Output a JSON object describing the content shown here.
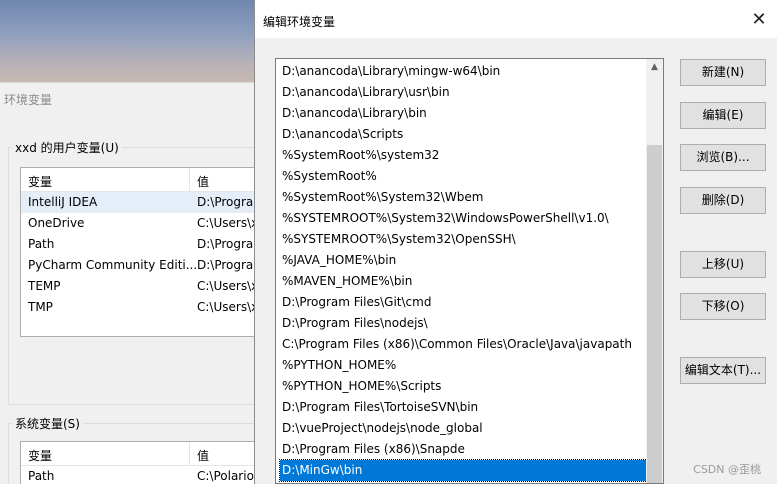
{
  "background_window": {
    "title": "环境变量",
    "user_vars": {
      "group_label": "xxd 的用户变量(U)",
      "columns": [
        "变量",
        "值"
      ],
      "rows": [
        {
          "name": "IntelliJ IDEA",
          "value": "D:\\Progra"
        },
        {
          "name": "OneDrive",
          "value": "C:\\Users\\x"
        },
        {
          "name": "Path",
          "value": "D:\\Progra"
        },
        {
          "name": "PyCharm Community Editi...",
          "value": "D:\\Progra"
        },
        {
          "name": "TEMP",
          "value": "C:\\Users\\x"
        },
        {
          "name": "TMP",
          "value": "C:\\Users\\x"
        }
      ]
    },
    "system_vars": {
      "group_label": "系统变量(S)",
      "columns": [
        "变量",
        "值"
      ],
      "rows": [
        {
          "name": "Path",
          "value": "C:\\Polario"
        }
      ]
    }
  },
  "dialog": {
    "title": "编辑环境变量",
    "close_glyph": "✕",
    "paths": [
      "D:\\anancoda\\Library\\mingw-w64\\bin",
      "D:\\anancoda\\Library\\usr\\bin",
      "D:\\anancoda\\Library\\bin",
      "D:\\anancoda\\Scripts",
      "%SystemRoot%\\system32",
      "%SystemRoot%",
      "%SystemRoot%\\System32\\Wbem",
      "%SYSTEMROOT%\\System32\\WindowsPowerShell\\v1.0\\",
      "%SYSTEMROOT%\\System32\\OpenSSH\\",
      "%JAVA_HOME%\\bin",
      "%MAVEN_HOME%\\bin",
      "D:\\Program Files\\Git\\cmd",
      "D:\\Program Files\\nodejs\\",
      "C:\\Program Files (x86)\\Common Files\\Oracle\\Java\\javapath",
      "%PYTHON_HOME%",
      "%PYTHON_HOME%\\Scripts",
      "D:\\Program Files\\TortoiseSVN\\bin",
      "D:\\vueProject\\nodejs\\node_global",
      "D:\\Program Files (x86)\\Snapde",
      "D:\\MinGw\\bin"
    ],
    "selected_index": 19,
    "buttons": {
      "new": "新建(N)",
      "edit": "编辑(E)",
      "browse": "浏览(B)...",
      "delete": "删除(D)",
      "move_up": "上移(U)",
      "move_down": "下移(O)",
      "edit_text": "编辑文本(T)..."
    },
    "scroll_up_glyph": "▲"
  },
  "watermark": "CSDN @歪桃"
}
